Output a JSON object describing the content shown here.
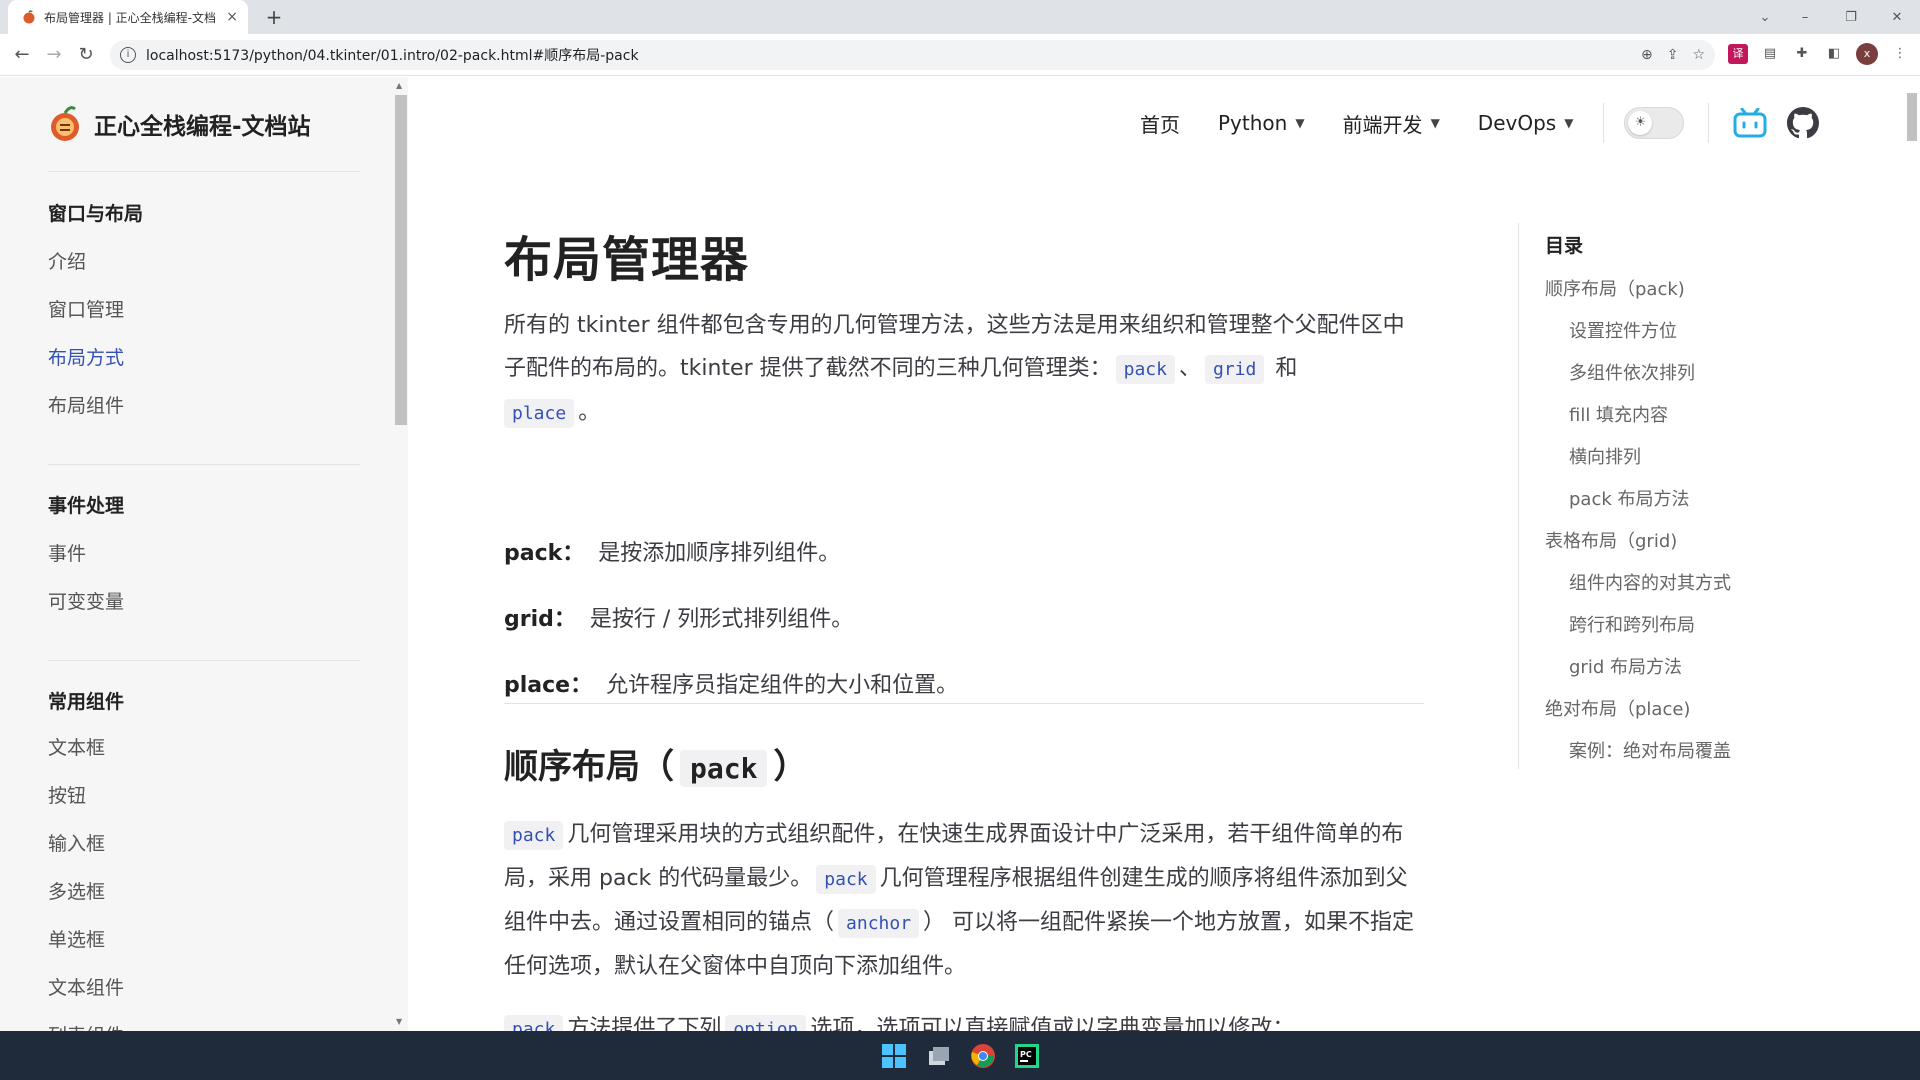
{
  "browser": {
    "tab_title": "布局管理器 | 正心全栈编程-文档",
    "tab_close": "×",
    "new_tab": "+",
    "url": "localhost:5173/python/04.tkinter/01.intro/02-pack.html#顺序布局-pack",
    "window_controls": [
      "⌄",
      "–",
      "❐",
      "✕"
    ],
    "avatar_letter": "x"
  },
  "site": {
    "title": "正心全栈编程-文档站"
  },
  "topnav": {
    "items": [
      {
        "label": "首页",
        "has_dropdown": false
      },
      {
        "label": "Python",
        "has_dropdown": true
      },
      {
        "label": "前端开发",
        "has_dropdown": true
      },
      {
        "label": "DevOps",
        "has_dropdown": true
      }
    ]
  },
  "sidebar": {
    "groups": [
      {
        "title": "窗口与布局",
        "items": [
          "介绍",
          "窗口管理",
          "布局方式",
          "布局组件"
        ],
        "active": "布局方式"
      },
      {
        "title": "事件处理",
        "items": [
          "事件",
          "可变变量"
        ]
      },
      {
        "title": "常用组件",
        "items": [
          "文本框",
          "按钮",
          "输入框",
          "多选框",
          "单选框",
          "文本组件",
          "列表组件"
        ]
      }
    ]
  },
  "article": {
    "title": "布局管理器",
    "intro_part1": "所有的 tkinter 组件都包含专用的几何管理方法，这些方法是用来组织和管理整个父配件区中子配件的布局的。tkinter 提供了截然不同的三种几何管理类：",
    "intro_code1": "pack",
    "intro_sep1": "、",
    "intro_code2": "grid",
    "intro_sep2": " 和",
    "intro_code3": "place",
    "intro_end": "。",
    "defs": [
      {
        "term": "pack：",
        "desc": "是按添加顺序排列组件。"
      },
      {
        "term": "grid：",
        "desc": "是按行 / 列形式排列组件。"
      },
      {
        "term": "place：",
        "desc": "允许程序员指定组件的大小和位置。"
      }
    ],
    "section_title_prefix": "顺序布局（",
    "section_title_code": "pack",
    "section_title_suffix": "）",
    "p2_code1": "pack",
    "p2_text1": "几何管理采用块的方式组织配件，在快速生成界面设计中广泛采用，若干组件简单的布局，采用 pack 的代码量最少。",
    "p2_code2": "pack",
    "p2_text2": "几何管理程序根据组件创建生成的顺序将组件添加到父组件中去。通过设置相同的锚点（",
    "p2_code3": "anchor",
    "p2_text3": "） 可以将一组配件紧挨一个地方放置，如果不指定任何选项，默认在父窗体中自顶向下添加组件。",
    "p3_code1": "pack",
    "p3_text1": "方法提供了下列",
    "p3_code2": "option",
    "p3_text2": "选项，选项可以直接赋值或以字典变量加以修改："
  },
  "toc": {
    "title": "目录",
    "items": [
      {
        "label": "顺序布局（pack)",
        "level": 1
      },
      {
        "label": "设置控件方位",
        "level": 2
      },
      {
        "label": "多组件依次排列",
        "level": 2
      },
      {
        "label": "fill 填充内容",
        "level": 2
      },
      {
        "label": "横向排列",
        "level": 2
      },
      {
        "label": "pack 布局方法",
        "level": 2
      },
      {
        "label": "表格布局（grid)",
        "level": 1
      },
      {
        "label": "组件内容的对其方式",
        "level": 2
      },
      {
        "label": "跨行和跨列布局",
        "level": 2
      },
      {
        "label": "grid 布局方法",
        "level": 2
      },
      {
        "label": "绝对布局（place)",
        "level": 1
      },
      {
        "label": "案例：绝对布局覆盖",
        "level": 2
      }
    ]
  },
  "colors": {
    "accent": "#3451b2",
    "sidebar_bg": "#f6f6f7",
    "code_bg": "#f1f1f3",
    "taskbar": "#1f2a3a"
  }
}
